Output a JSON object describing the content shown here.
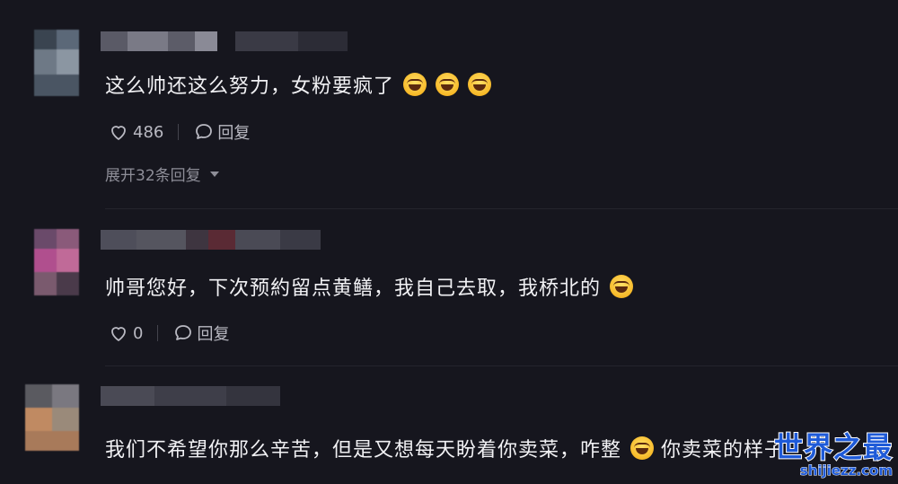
{
  "comments": [
    {
      "text": "这么帅还这么努力，女粉要疯了",
      "emoji_count": 3,
      "likes": "486",
      "reply_label": "回复",
      "expand_label": "展开32条回复"
    },
    {
      "text": "帅哥您好，下次预約留点黄鳝，我自己去取，我桥北的",
      "emoji_count": 1,
      "likes": "0",
      "reply_label": "回复"
    },
    {
      "text": "我们不希望你那么辛苦，但是又想每天盼着你卖菜，咋整",
      "text_after_emoji": "你卖菜的样子",
      "emoji_count": 1
    }
  ],
  "watermark": {
    "title": "世界之最",
    "url": "shijiezz.com"
  },
  "icons": {
    "like": "heart-outline-icon",
    "reply": "chat-bubble-icon",
    "expand": "caret-down-icon",
    "emoji": "laughing-emoji-icon"
  },
  "colors": {
    "background": "#16161e",
    "text": "#f1f1f4",
    "muted": "#b9b9c2",
    "watermark": "#1e5ad8"
  }
}
